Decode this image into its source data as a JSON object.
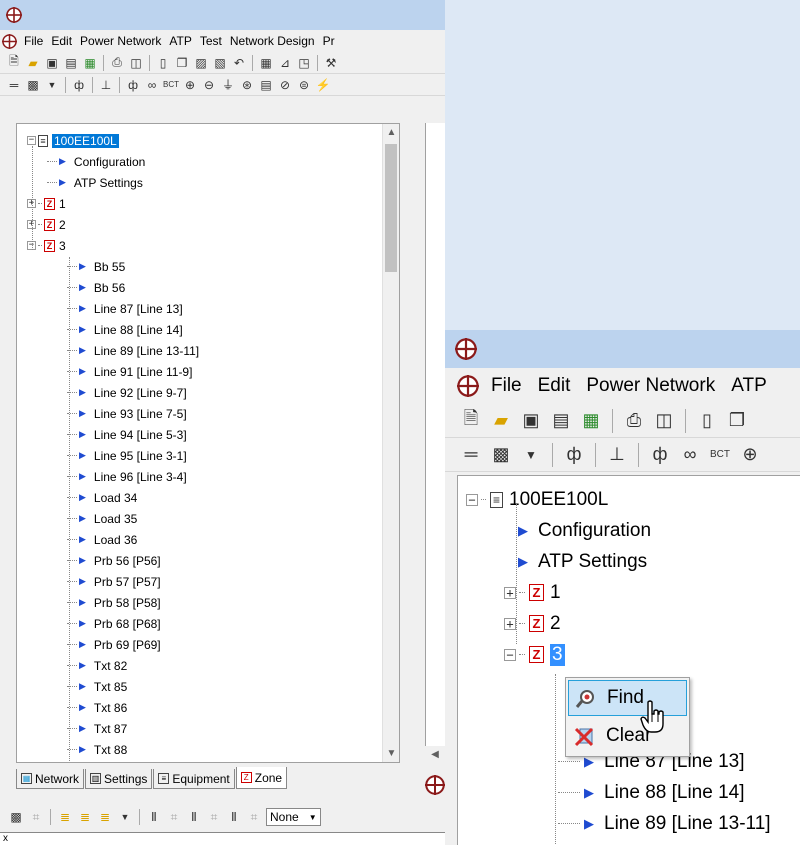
{
  "colors": {
    "selection": "#0078d7",
    "zone_icon": "#cc0000",
    "tree_arrow": "#1f4bd1",
    "titlebar": "#bcd3ee"
  },
  "app_icon": "crosshair-circle-icon",
  "menu": [
    "File",
    "Edit",
    "Power Network",
    "ATP",
    "Test",
    "Network Design",
    "Pr"
  ],
  "menu_b": [
    "File",
    "Edit",
    "Power Network",
    "ATP"
  ],
  "tree": {
    "root": "100EE100L",
    "configuration": "Configuration",
    "atp_settings": "ATP Settings",
    "zone1": "1",
    "zone2": "2",
    "zone3": "3",
    "zone3_children": [
      "Bb 55",
      "Bb 56",
      "Line 87 [Line 13]",
      "Line 88 [Line 14]",
      "Line 89 [Line 13-11]",
      "Line 91 [Line 11-9]",
      "Line 92 [Line 9-7]",
      "Line 93 [Line 7-5]",
      "Line 94 [Line 5-3]",
      "Line 95 [Line 3-1]",
      "Line 96 [Line 3-4]",
      "Load 34",
      "Load 35",
      "Load 36",
      "Prb 56 [P56]",
      "Prb 57 [P57]",
      "Prb 58 [P58]",
      "Prb 68 [P68]",
      "Prb 69 [P69]",
      "Txt 82",
      "Txt 85",
      "Txt 86",
      "Txt 87",
      "Txt 88"
    ],
    "zone3_children_b": [
      "Line 87 [Line 13]",
      "Line 88 [Line 14]",
      "Line 89 [Line 13-11]"
    ]
  },
  "tabs": [
    {
      "label": "Network",
      "icon": "network-icon"
    },
    {
      "label": "Settings",
      "icon": "settings-book-icon"
    },
    {
      "label": "Equipment",
      "icon": "equipment-icon"
    },
    {
      "label": "Zone",
      "icon": "zone-icon",
      "active": true
    }
  ],
  "bottom_combo": "None",
  "status_field": "x",
  "context_menu": [
    {
      "label": "Find",
      "icon": "find-magnifier-icon",
      "hover": true
    },
    {
      "label": "Clear",
      "icon": "clear-x-icon"
    }
  ]
}
